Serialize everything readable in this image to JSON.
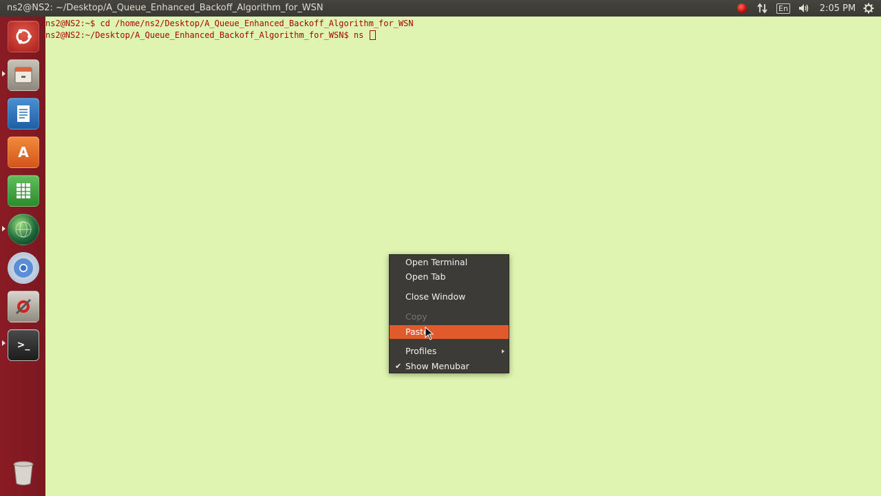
{
  "top_panel": {
    "window_title": "ns2@NS2: ~/Desktop/A_Queue_Enhanced_Backoff_Algorithm_for_WSN",
    "indicators": [
      {
        "icon": "recording-icon"
      },
      {
        "icon": "network-arrows-icon"
      },
      {
        "label": "En",
        "icon": "keyboard-layout-icon"
      },
      {
        "icon": "volume-icon"
      },
      {
        "clock": "2:05 PM"
      },
      {
        "icon": "gear-icon"
      }
    ]
  },
  "launcher": {
    "items": [
      {
        "name": "dash-home",
        "icon": "ubuntu-logo-icon"
      },
      {
        "name": "files",
        "icon": "file-cabinet-icon"
      },
      {
        "name": "writer",
        "icon": "document-icon"
      },
      {
        "name": "software-center",
        "icon": "software-center-icon",
        "glyph": "A"
      },
      {
        "name": "calc",
        "icon": "spreadsheet-icon"
      },
      {
        "name": "browser-globe",
        "icon": "globe-icon"
      },
      {
        "name": "chromium",
        "icon": "chromium-icon"
      },
      {
        "name": "system-settings",
        "icon": "settings-tools-icon"
      },
      {
        "name": "terminal",
        "icon": "terminal-icon",
        "glyph": ">_"
      },
      {
        "name": "trash",
        "icon": "trash-icon"
      }
    ]
  },
  "terminal": {
    "lines": [
      "ns2@NS2:~$ cd /home/ns2/Desktop/A_Queue_Enhanced_Backoff_Algorithm_for_WSN",
      "ns2@NS2:~/Desktop/A_Queue_Enhanced_Backoff_Algorithm_for_WSN$ ns "
    ]
  },
  "context_menu": {
    "items": [
      {
        "label": "Open Terminal",
        "state": "normal"
      },
      {
        "label": "Open Tab",
        "state": "normal"
      },
      {
        "label": "Close Window",
        "state": "normal"
      },
      {
        "label": "Copy",
        "state": "disabled"
      },
      {
        "label": "Paste",
        "state": "active"
      },
      {
        "label": "Profiles",
        "state": "submenu"
      },
      {
        "label": "Show Menubar",
        "state": "checked"
      }
    ]
  },
  "colors": {
    "terminal_bg": "#dff4b0",
    "terminal_fg": "#a30707",
    "launcher_bg": "#8a1b24",
    "menu_bg": "#3c3b37",
    "menu_highlight": "#e05a2b"
  }
}
